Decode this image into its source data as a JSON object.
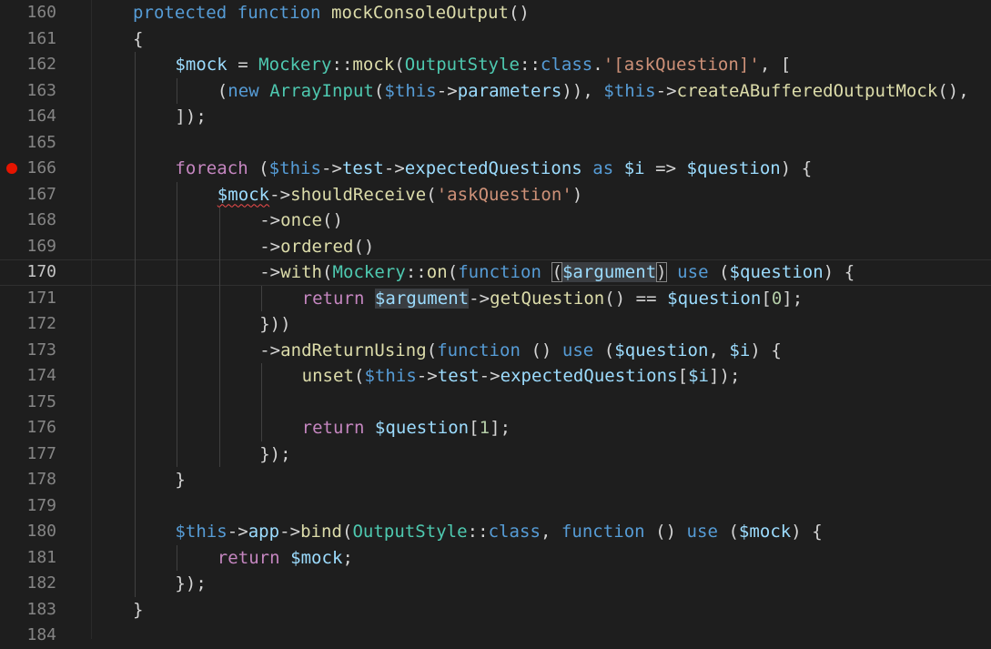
{
  "colors": {
    "background": "#1e1e1e",
    "line_number": "#858585",
    "line_number_active": "#c6c6c6",
    "keyword": "#569cd6",
    "control_keyword": "#c586c0",
    "function": "#dcdcaa",
    "class": "#4ec9b0",
    "variable": "#9cdcfe",
    "string": "#ce9178",
    "number": "#b5cea8",
    "default": "#d4d4d4",
    "breakpoint": "#e51400"
  },
  "editor": {
    "current_line": 170,
    "breakpoint_line": 166,
    "lines": [
      {
        "num": "160",
        "indent": 1,
        "tokens": [
          {
            "t": "protected",
            "c": "kw"
          },
          {
            "t": " "
          },
          {
            "t": "function",
            "c": "kw"
          },
          {
            "t": " "
          },
          {
            "t": "mockConsoleOutput",
            "c": "fn"
          },
          {
            "t": "()"
          }
        ]
      },
      {
        "num": "161",
        "indent": 1,
        "tokens": [
          {
            "t": "{"
          }
        ]
      },
      {
        "num": "162",
        "indent": 2,
        "tokens": [
          {
            "t": "$mock",
            "c": "var"
          },
          {
            "t": " = "
          },
          {
            "t": "Mockery",
            "c": "cls"
          },
          {
            "t": "::"
          },
          {
            "t": "mock",
            "c": "fn"
          },
          {
            "t": "("
          },
          {
            "t": "OutputStyle",
            "c": "cls"
          },
          {
            "t": "::"
          },
          {
            "t": "class",
            "c": "kw"
          },
          {
            "t": "."
          },
          {
            "t": "'[askQuestion]'",
            "c": "str"
          },
          {
            "t": ", ["
          }
        ]
      },
      {
        "num": "163",
        "indent": 3,
        "tokens": [
          {
            "t": "("
          },
          {
            "t": "new",
            "c": "kw"
          },
          {
            "t": " "
          },
          {
            "t": "ArrayInput",
            "c": "cls"
          },
          {
            "t": "("
          },
          {
            "t": "$this",
            "c": "kw"
          },
          {
            "t": "->"
          },
          {
            "t": "parameters",
            "c": "var"
          },
          {
            "t": ")), "
          },
          {
            "t": "$this",
            "c": "kw"
          },
          {
            "t": "->"
          },
          {
            "t": "createABufferedOutputMock",
            "c": "fn"
          },
          {
            "t": "(),"
          }
        ]
      },
      {
        "num": "164",
        "indent": 2,
        "tokens": [
          {
            "t": "]);"
          }
        ]
      },
      {
        "num": "165",
        "indent": 2,
        "tokens": []
      },
      {
        "num": "166",
        "indent": 2,
        "tokens": [
          {
            "t": "foreach",
            "c": "ctl"
          },
          {
            "t": " ("
          },
          {
            "t": "$this",
            "c": "kw"
          },
          {
            "t": "->"
          },
          {
            "t": "test",
            "c": "var"
          },
          {
            "t": "->"
          },
          {
            "t": "expectedQuestions",
            "c": "var"
          },
          {
            "t": " "
          },
          {
            "t": "as",
            "c": "kw"
          },
          {
            "t": " "
          },
          {
            "t": "$i",
            "c": "var"
          },
          {
            "t": " => "
          },
          {
            "t": "$question",
            "c": "var"
          },
          {
            "t": ") {"
          }
        ]
      },
      {
        "num": "167",
        "indent": 3,
        "tokens": [
          {
            "t": "$mock",
            "c": "var",
            "x": "squiggle"
          },
          {
            "t": "->"
          },
          {
            "t": "shouldReceive",
            "c": "fn"
          },
          {
            "t": "("
          },
          {
            "t": "'askQuestion'",
            "c": "str"
          },
          {
            "t": ")"
          }
        ]
      },
      {
        "num": "168",
        "indent": 4,
        "tokens": [
          {
            "t": "->"
          },
          {
            "t": "once",
            "c": "fn"
          },
          {
            "t": "()"
          }
        ]
      },
      {
        "num": "169",
        "indent": 4,
        "tokens": [
          {
            "t": "->"
          },
          {
            "t": "ordered",
            "c": "fn"
          },
          {
            "t": "()"
          }
        ]
      },
      {
        "num": "170",
        "indent": 4,
        "tokens": [
          {
            "t": "->"
          },
          {
            "t": "with",
            "c": "fn"
          },
          {
            "t": "("
          },
          {
            "t": "Mockery",
            "c": "cls"
          },
          {
            "t": "::"
          },
          {
            "t": "on",
            "c": "fn"
          },
          {
            "t": "("
          },
          {
            "t": "function",
            "c": "kw"
          },
          {
            "t": " "
          },
          {
            "t": "(",
            "x": "bracket"
          },
          {
            "t": "",
            "x": "cursor"
          },
          {
            "t": "$argument",
            "c": "var",
            "x": "hl"
          },
          {
            "t": ")",
            "x": "bracket"
          },
          {
            "t": " "
          },
          {
            "t": "use",
            "c": "kw"
          },
          {
            "t": " ("
          },
          {
            "t": "$question",
            "c": "var"
          },
          {
            "t": ") {"
          }
        ]
      },
      {
        "num": "171",
        "indent": 5,
        "tokens": [
          {
            "t": "return",
            "c": "ctl"
          },
          {
            "t": " "
          },
          {
            "t": "$argument",
            "c": "var",
            "x": "hl"
          },
          {
            "t": "->"
          },
          {
            "t": "getQuestion",
            "c": "fn"
          },
          {
            "t": "() == "
          },
          {
            "t": "$question",
            "c": "var"
          },
          {
            "t": "["
          },
          {
            "t": "0",
            "c": "num"
          },
          {
            "t": "];"
          }
        ]
      },
      {
        "num": "172",
        "indent": 4,
        "tokens": [
          {
            "t": "}))"
          }
        ]
      },
      {
        "num": "173",
        "indent": 4,
        "tokens": [
          {
            "t": "->"
          },
          {
            "t": "andReturnUsing",
            "c": "fn"
          },
          {
            "t": "("
          },
          {
            "t": "function",
            "c": "kw"
          },
          {
            "t": " () "
          },
          {
            "t": "use",
            "c": "kw"
          },
          {
            "t": " ("
          },
          {
            "t": "$question",
            "c": "var"
          },
          {
            "t": ", "
          },
          {
            "t": "$i",
            "c": "var"
          },
          {
            "t": ") {"
          }
        ]
      },
      {
        "num": "174",
        "indent": 5,
        "tokens": [
          {
            "t": "unset",
            "c": "fn"
          },
          {
            "t": "("
          },
          {
            "t": "$this",
            "c": "kw"
          },
          {
            "t": "->"
          },
          {
            "t": "test",
            "c": "var"
          },
          {
            "t": "->"
          },
          {
            "t": "expectedQuestions",
            "c": "var"
          },
          {
            "t": "["
          },
          {
            "t": "$i",
            "c": "var"
          },
          {
            "t": "]);"
          }
        ]
      },
      {
        "num": "175",
        "indent": 5,
        "tokens": []
      },
      {
        "num": "176",
        "indent": 5,
        "tokens": [
          {
            "t": "return",
            "c": "ctl"
          },
          {
            "t": " "
          },
          {
            "t": "$question",
            "c": "var"
          },
          {
            "t": "["
          },
          {
            "t": "1",
            "c": "num"
          },
          {
            "t": "];"
          }
        ]
      },
      {
        "num": "177",
        "indent": 4,
        "tokens": [
          {
            "t": "});"
          }
        ]
      },
      {
        "num": "178",
        "indent": 2,
        "tokens": [
          {
            "t": "}"
          }
        ]
      },
      {
        "num": "179",
        "indent": 2,
        "tokens": []
      },
      {
        "num": "180",
        "indent": 2,
        "tokens": [
          {
            "t": "$this",
            "c": "kw"
          },
          {
            "t": "->"
          },
          {
            "t": "app",
            "c": "var"
          },
          {
            "t": "->"
          },
          {
            "t": "bind",
            "c": "fn"
          },
          {
            "t": "("
          },
          {
            "t": "OutputStyle",
            "c": "cls"
          },
          {
            "t": "::"
          },
          {
            "t": "class",
            "c": "kw"
          },
          {
            "t": ", "
          },
          {
            "t": "function",
            "c": "kw"
          },
          {
            "t": " () "
          },
          {
            "t": "use",
            "c": "kw"
          },
          {
            "t": " ("
          },
          {
            "t": "$mock",
            "c": "var"
          },
          {
            "t": ") {"
          }
        ]
      },
      {
        "num": "181",
        "indent": 3,
        "tokens": [
          {
            "t": "return",
            "c": "ctl"
          },
          {
            "t": " "
          },
          {
            "t": "$mock",
            "c": "var"
          },
          {
            "t": ";"
          }
        ]
      },
      {
        "num": "182",
        "indent": 2,
        "tokens": [
          {
            "t": "});"
          }
        ]
      },
      {
        "num": "183",
        "indent": 1,
        "tokens": [
          {
            "t": "}"
          }
        ]
      },
      {
        "num": "184",
        "indent": 0,
        "tokens": []
      }
    ]
  }
}
